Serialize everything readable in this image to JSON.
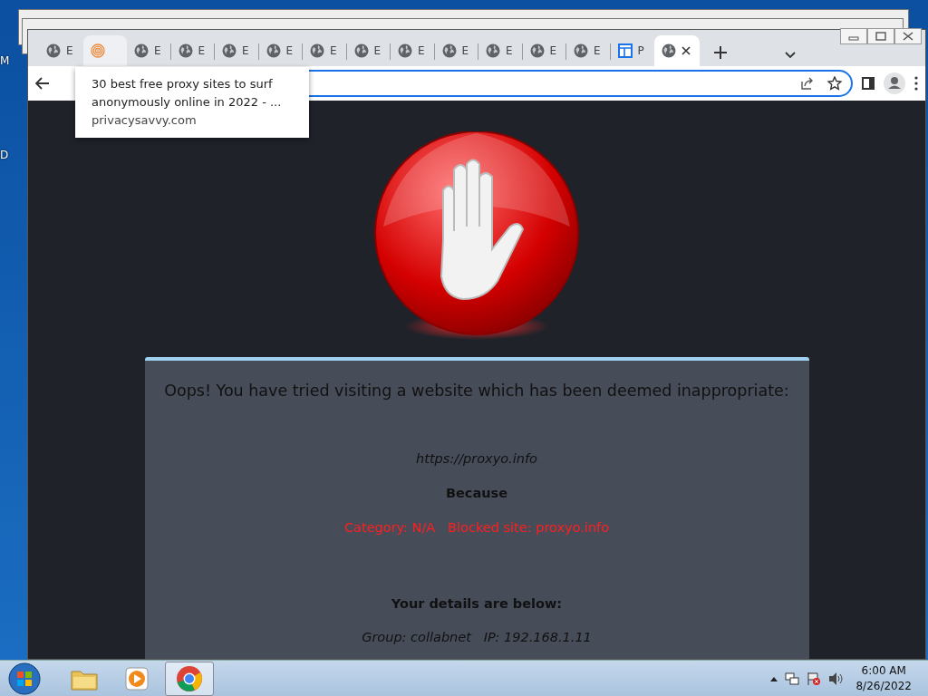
{
  "desktop": {
    "labels": [
      "M",
      "D"
    ]
  },
  "browser": {
    "tabs": [
      {
        "label": "E",
        "kind": "globe",
        "selected": false,
        "hovered": false
      },
      {
        "kind": "fingerprint",
        "selected": false,
        "hovered": true
      },
      {
        "label": "E",
        "kind": "globe",
        "selected": false,
        "hovered": false
      },
      {
        "label": "E",
        "kind": "globe",
        "selected": false,
        "hovered": false
      },
      {
        "label": "E",
        "kind": "globe",
        "selected": false,
        "hovered": false
      },
      {
        "label": "E",
        "kind": "globe",
        "selected": false,
        "hovered": false
      },
      {
        "label": "E",
        "kind": "globe",
        "selected": false,
        "hovered": false
      },
      {
        "label": "E",
        "kind": "globe",
        "selected": false,
        "hovered": false
      },
      {
        "label": "E",
        "kind": "globe",
        "selected": false,
        "hovered": false
      },
      {
        "label": "E",
        "kind": "globe",
        "selected": false,
        "hovered": false
      },
      {
        "label": "E",
        "kind": "globe",
        "selected": false,
        "hovered": false
      },
      {
        "label": "E",
        "kind": "globe",
        "selected": false,
        "hovered": false
      },
      {
        "label": "E",
        "kind": "globe",
        "selected": false,
        "hovered": false
      },
      {
        "label": "P",
        "kind": "layout",
        "selected": false,
        "hovered": false
      },
      {
        "kind": "globe",
        "selected": true,
        "hovered": false
      }
    ],
    "tooltip": {
      "title": "30 best free proxy sites to surf anonymously online in 2022 - ...",
      "domain": "privacysavvy.com"
    }
  },
  "block_page": {
    "heading": "Oops! You have tried visiting a website which has been deemed inappropriate:",
    "url": "https://proxyo.info",
    "because": "Because",
    "reason": "Category: N/A   Blocked site: proxyo.info",
    "details_heading": "Your details are below:",
    "details": "Group: collabnet   IP: 192.168.1.11"
  },
  "taskbar": {
    "apps": [
      {
        "kind": "folder",
        "selected": false
      },
      {
        "kind": "media",
        "selected": false
      },
      {
        "kind": "chrome",
        "selected": true
      }
    ],
    "time": "6:00 AM",
    "date": "8/26/2022"
  }
}
